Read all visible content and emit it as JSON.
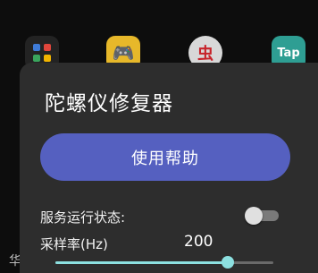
{
  "home_screen": {
    "apps": [
      {
        "name": "folder-app",
        "glyph_colors": [
          "#3e7bd8",
          "#e0463c",
          "#3aa55d",
          "#f2b400"
        ]
      },
      {
        "name": "game-app",
        "glyph": "🎮"
      },
      {
        "name": "red-app",
        "glyph": "虫"
      },
      {
        "name": "tap-app",
        "glyph": "Tap"
      }
    ],
    "left_fragments": [
      "",
      "华"
    ]
  },
  "dialog": {
    "title": "陀螺仪修复器",
    "help_button_label": "使用帮助",
    "service_status_label": "服务运行状态:",
    "service_enabled": false,
    "sample_rate_label": "采样率(Hz)",
    "sample_rate_value": "200",
    "sample_rate_slider_fraction": 0.79
  },
  "colors": {
    "accent": "#8ce0e0",
    "button": "#5560c0",
    "dialog_bg": "#2d2d2d"
  }
}
